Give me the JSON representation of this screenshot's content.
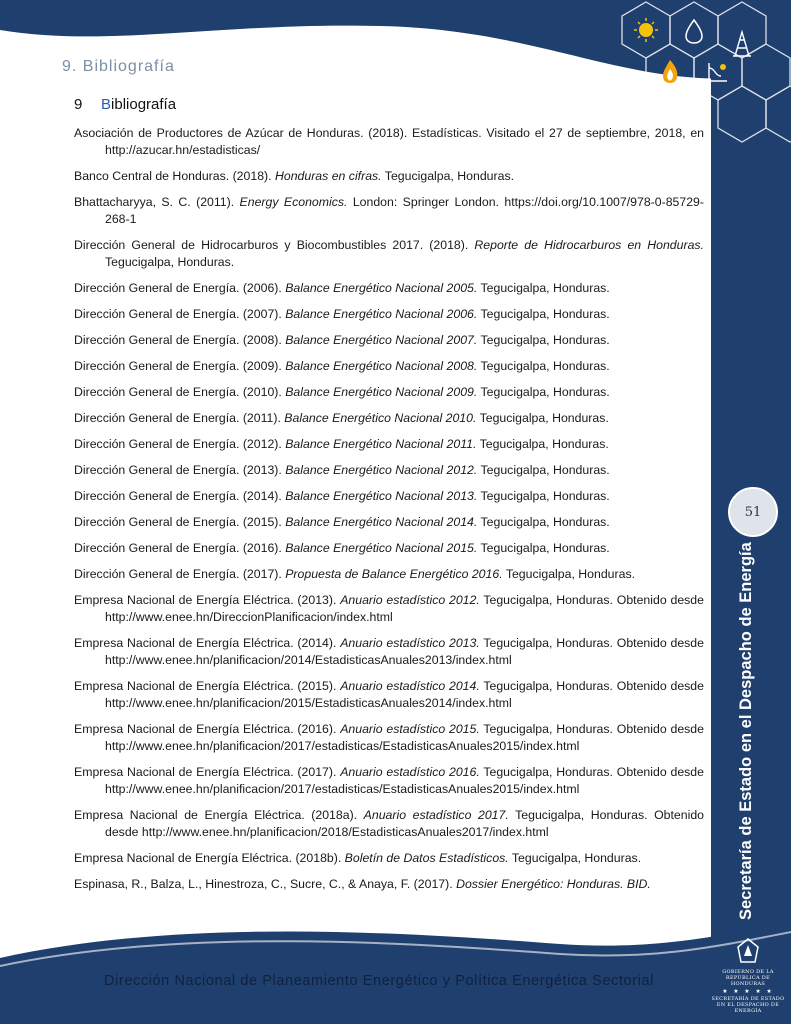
{
  "header": {
    "section_title": "9. Bibliografía"
  },
  "heading": {
    "number": "9",
    "first_letter": "B",
    "rest": "ibliografía"
  },
  "entries": [
    {
      "before": "Asociación de Productores de Azúcar de Honduras. (2018). Estadísticas. Visitado el 27 de septiembre, 2018, en http://azucar.hn/estadisticas/",
      "italic": "",
      "after": ""
    },
    {
      "before": "Banco Central de Honduras. (2018). ",
      "italic": "Honduras en cifras.",
      "after": " Tegucigalpa, Honduras."
    },
    {
      "before": "Bhattacharyya, S. C. (2011). ",
      "italic": "Energy Economics.",
      "after": " London: Springer London. https://doi.org/10.1007/978-0-85729-268-1"
    },
    {
      "before": "Dirección General de Hidrocarburos y Biocombustibles 2017. (2018). ",
      "italic": "Reporte de Hidrocarburos en Honduras.",
      "after": " Tegucigalpa, Honduras."
    },
    {
      "before": "Dirección General de Energía. (2006). ",
      "italic": "Balance Energético Nacional 2005.",
      "after": " Tegucigalpa, Honduras."
    },
    {
      "before": "Dirección General de Energía. (2007). ",
      "italic": "Balance Energético Nacional 2006.",
      "after": " Tegucigalpa, Honduras."
    },
    {
      "before": "Dirección General de Energía. (2008). ",
      "italic": "Balance Energético Nacional 2007.",
      "after": " Tegucigalpa, Honduras."
    },
    {
      "before": "Dirección General de Energía. (2009). ",
      "italic": "Balance Energético Nacional 2008.",
      "after": " Tegucigalpa, Honduras."
    },
    {
      "before": "Dirección General de Energía. (2010). ",
      "italic": "Balance Energético Nacional 2009.",
      "after": " Tegucigalpa, Honduras."
    },
    {
      "before": "Dirección General de Energía. (2011). ",
      "italic": "Balance Energético Nacional 2010.",
      "after": " Tegucigalpa, Honduras."
    },
    {
      "before": "Dirección General de Energía. (2012). ",
      "italic": "Balance Energético Nacional 2011.",
      "after": " Tegucigalpa, Honduras."
    },
    {
      "before": "Dirección General de Energía. (2013). ",
      "italic": "Balance Energético Nacional 2012.",
      "after": " Tegucigalpa, Honduras."
    },
    {
      "before": "Dirección General de Energía. (2014). ",
      "italic": "Balance Energético Nacional 2013.",
      "after": " Tegucigalpa, Honduras."
    },
    {
      "before": "Dirección General de Energía. (2015). ",
      "italic": "Balance Energético Nacional 2014.",
      "after": " Tegucigalpa, Honduras."
    },
    {
      "before": "Dirección General de Energía. (2016). ",
      "italic": "Balance Energético Nacional 2015.",
      "after": " Tegucigalpa, Honduras."
    },
    {
      "before": "Dirección General de Energía. (2017). ",
      "italic": "Propuesta de Balance Energético 2016.",
      "after": " Tegucigalpa, Honduras."
    },
    {
      "before": "Empresa Nacional de Energía Eléctrica. (2013). ",
      "italic": "Anuario estadístico 2012.",
      "after": " Tegucigalpa, Honduras. Obtenido desde http://www.enee.hn/DireccionPlanificacion/index.html"
    },
    {
      "before": "Empresa Nacional de Energía Eléctrica. (2014). ",
      "italic": "Anuario estadístico 2013.",
      "after": " Tegucigalpa, Honduras. Obtenido desde http://www.enee.hn/planificacion/2014/EstadisticasAnuales2013/index.html"
    },
    {
      "before": "Empresa Nacional de Energía Eléctrica. (2015). ",
      "italic": "Anuario estadístico 2014.",
      "after": " Tegucigalpa, Honduras. Obtenido desde http://www.enee.hn/planificacion/2015/EstadisticasAnuales2014/index.html"
    },
    {
      "before": "Empresa Nacional de Energía Eléctrica. (2016). ",
      "italic": "Anuario estadístico 2015.",
      "after": " Tegucigalpa, Honduras. Obtenido desde http://www.enee.hn/planificacion/2017/estadisticas/EstadisticasAnuales2015/index.html"
    },
    {
      "before": "Empresa Nacional de Energía Eléctrica. (2017). ",
      "italic": "Anuario estadístico 2016.",
      "after": " Tegucigalpa, Honduras. Obtenido desde http://www.enee.hn/planificacion/2017/estadisticas/EstadisticasAnuales2015/index.html"
    },
    {
      "before": "Empresa Nacional de Energía Eléctrica. (2018a). ",
      "italic": "Anuario estadístico 2017.",
      "after": " Tegucigalpa, Honduras. Obtenido desde http://www.enee.hn/planificacion/2018/EstadisticasAnuales2017/index.html"
    },
    {
      "before": "Empresa Nacional de Energía Eléctrica. (2018b). ",
      "italic": "Boletín de Datos Estadísticos.",
      "after": " Tegucigalpa, Honduras."
    },
    {
      "before": "Espinasa, R., Balza, L., Hinestroza, C., Sucre, C., & Anaya, F. (2017). ",
      "italic": "Dossier Energético: Honduras. BID.",
      "after": ""
    }
  ],
  "page_number": "51",
  "sidebar": {
    "vertical_title": "Secretaría de Estado en el Despacho de Energía"
  },
  "footer": {
    "text": "Dirección Nacional de Planeamiento Energético y Política Energética Sectorial"
  },
  "logo": {
    "line1": "GOBIERNO DE LA",
    "line2": "REPÚBLICA DE HONDURAS",
    "stars": "★ ★ ★ ★ ★",
    "line3": "SECRETARÍA DE ESTADO",
    "line4": "EN EL DESPACHO DE ENERGÍA"
  },
  "colors": {
    "navy": "#1f3f6e",
    "dark_navy": "#132c52",
    "accent_blue": "#2f5ea8",
    "section_gray": "#7b8fa6"
  },
  "icons": [
    "sun-icon",
    "water-drop-icon",
    "flame-icon",
    "dam-icon",
    "oil-derrick-icon",
    "hexagon-pattern"
  ]
}
